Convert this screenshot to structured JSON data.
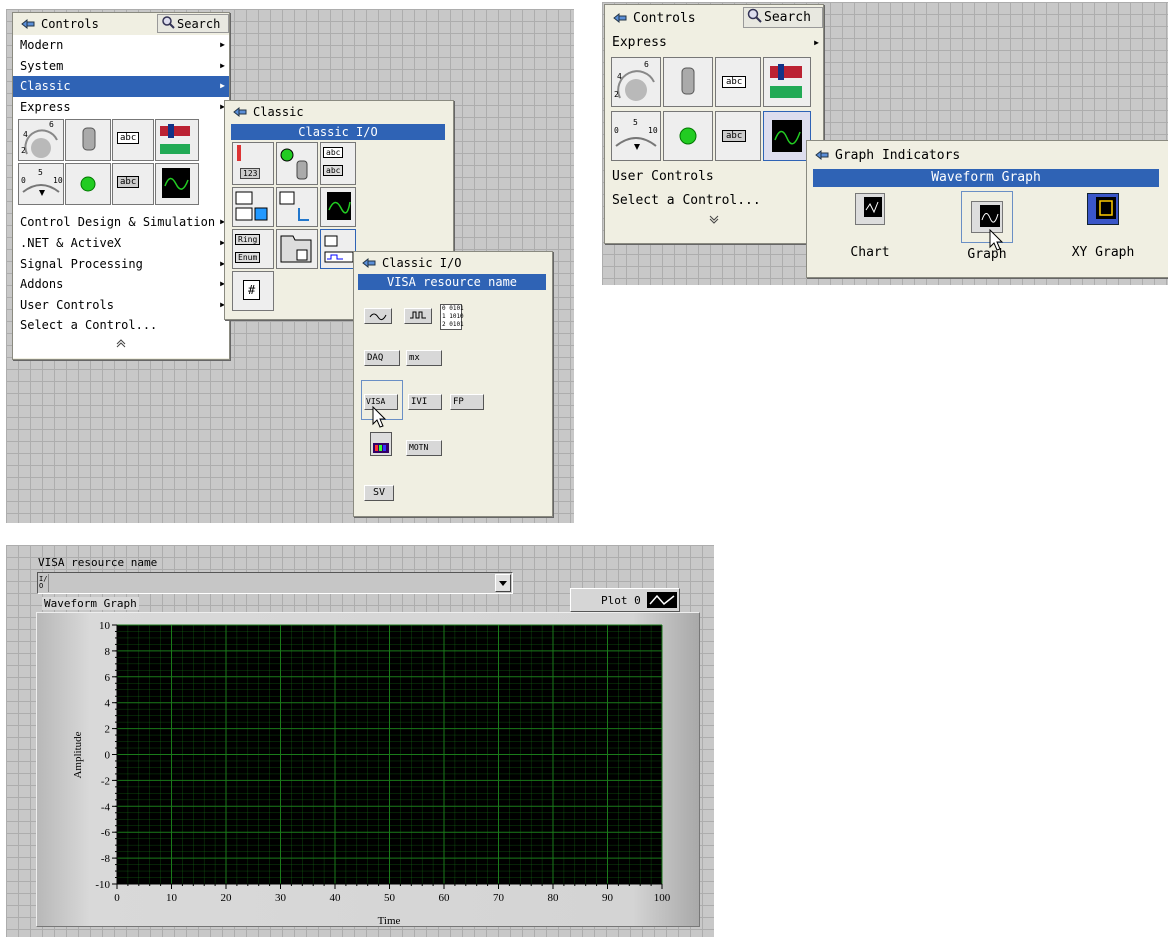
{
  "controls_palette": {
    "title": "Controls",
    "search_label": "Search",
    "items": [
      {
        "label": "Modern",
        "submenu": true
      },
      {
        "label": "System",
        "submenu": true
      },
      {
        "label": "Classic",
        "submenu": true,
        "selected": true
      },
      {
        "label": "Express",
        "submenu": true
      }
    ],
    "lower_items": [
      {
        "label": "Control Design & Simulation",
        "submenu": true
      },
      {
        "label": ".NET & ActiveX",
        "submenu": true
      },
      {
        "label": "Signal Processing",
        "submenu": true
      },
      {
        "label": "Addons",
        "submenu": true
      },
      {
        "label": "User Controls",
        "submenu": true
      },
      {
        "label": "Select a Control...",
        "submenu": false
      }
    ],
    "tile_texts": {
      "abc": "abc",
      "dial_max": "6",
      "dial_min": "2",
      "dial_mid": "4",
      "slide_lo": "0",
      "slide_mid": "5",
      "slide_hi": "10"
    },
    "collapse_glyph": "≈"
  },
  "classic_palette": {
    "title": "Classic",
    "band": "Classic I/O",
    "tile_texts": {
      "num": "123",
      "abc": "abc",
      "ring": "Ring",
      "enum": "Enum",
      "hash": "#"
    }
  },
  "classic_io_palette": {
    "title": "Classic I/O",
    "band": "VISA resource name",
    "tiles": {
      "daq": "DAQ",
      "mx": "mx",
      "visa": "VISA",
      "ivi": "IVI",
      "fp": "FP",
      "motn": "MOTN",
      "sv": "SV",
      "bits": "0 0101\n1 1010\n2 0101"
    }
  },
  "right_controls_palette": {
    "title": "Controls",
    "search_label": "Search",
    "express_label": "Express",
    "user_controls_label": "User Controls",
    "select_label": "Select a Control...",
    "expand_glyph": "≫",
    "tile_texts": {
      "abc": "abc",
      "dial_max": "6",
      "dial_min": "2",
      "dial_mid": "4",
      "slide_lo": "0",
      "slide_mid": "5",
      "slide_hi": "10"
    }
  },
  "graph_indicators_palette": {
    "title": "Graph Indicators",
    "band": "Waveform Graph",
    "items": [
      {
        "label": "Chart"
      },
      {
        "label": "Graph"
      },
      {
        "label": "XY Graph"
      }
    ]
  },
  "front_panel": {
    "visa_label": "VISA resource name",
    "visa_prefix": "I/O",
    "graph_label": "Waveform Graph",
    "plot_legend": "Plot 0"
  },
  "chart_data": {
    "type": "line",
    "title": "",
    "xlabel": "Time",
    "ylabel": "Amplitude",
    "xlim": [
      0,
      100
    ],
    "ylim": [
      -10,
      10
    ],
    "x_ticks": [
      0,
      10,
      20,
      30,
      40,
      50,
      60,
      70,
      80,
      90,
      100
    ],
    "y_ticks": [
      10,
      8,
      6,
      4,
      2,
      0,
      -2,
      -4,
      -6,
      -8,
      -10
    ],
    "grid": true,
    "plot_background": "#000000",
    "grid_color": "#1a7a1a",
    "legend": "top-right",
    "series": [
      {
        "name": "Plot 0",
        "x": [],
        "y": []
      }
    ]
  },
  "colors": {
    "selection": "#2f63b5",
    "palette_bg": "#f0efe2",
    "grid_bg": "#c8c8c8"
  }
}
